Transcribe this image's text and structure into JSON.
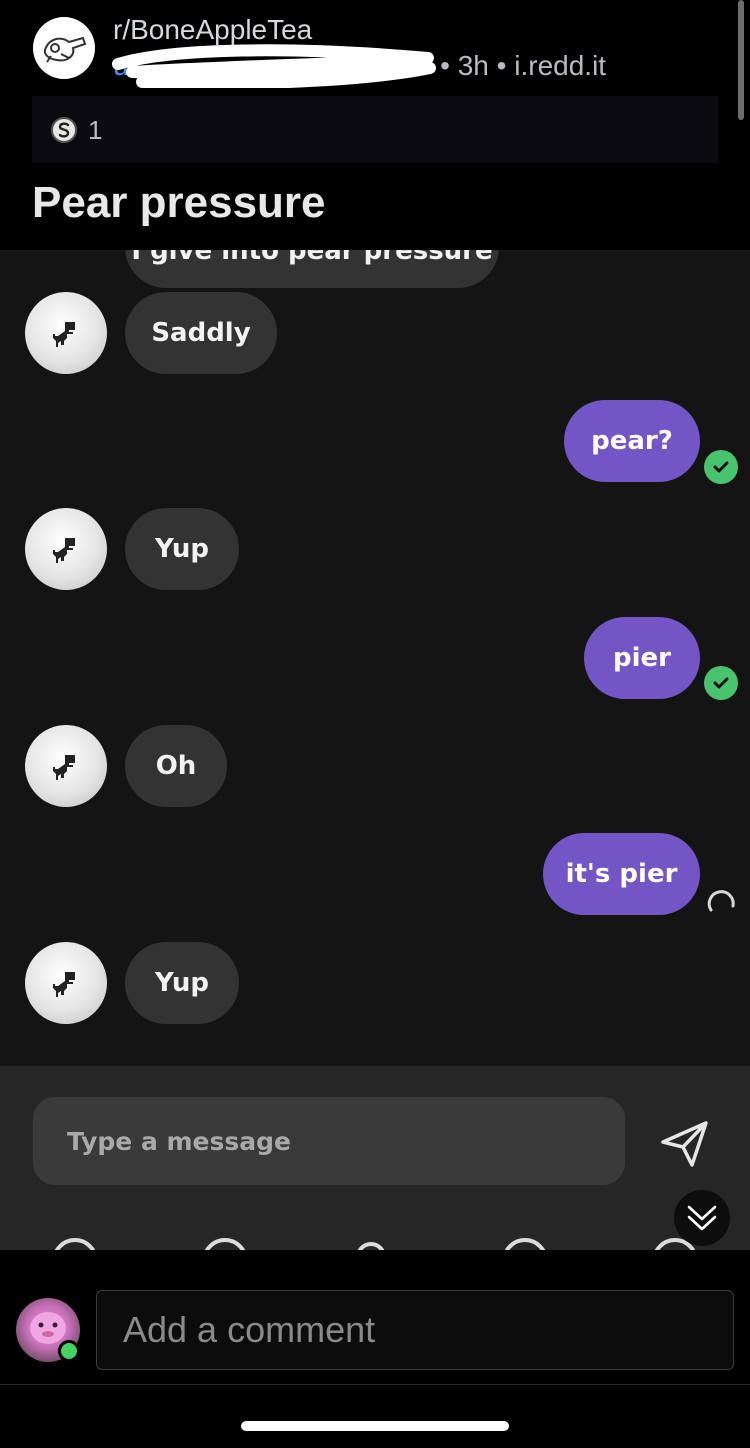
{
  "post": {
    "subreddit": "r/BoneAppleTea",
    "age": "3h",
    "domain": "i.redd.it",
    "award_count": "1",
    "title": "Pear pressure"
  },
  "chat": {
    "partial_message": "I give into pear pressure",
    "messages": [
      {
        "side": "in",
        "text": "Saddly"
      },
      {
        "side": "out",
        "text": "pear?",
        "status": "sent"
      },
      {
        "side": "in",
        "text": "Yup"
      },
      {
        "side": "out",
        "text": "pier",
        "status": "sent"
      },
      {
        "side": "in",
        "text": "Oh"
      },
      {
        "side": "out",
        "text": "it's pier",
        "status": "sending"
      },
      {
        "side": "in",
        "text": "Yup"
      }
    ],
    "composer_placeholder": "Type a message"
  },
  "comment_bar": {
    "placeholder": "Add a comment"
  },
  "colors": {
    "outgoing_bubble": "#7355c6",
    "incoming_bubble": "#333333",
    "sent_check": "#48c46f",
    "online_status": "#46d160"
  },
  "icons": [
    "subreddit-avatar-icon",
    "award-icon",
    "dino-avatar-icon",
    "check-icon",
    "spinner-icon",
    "send-icon",
    "scroll-down-icon",
    "user-avatar"
  ]
}
